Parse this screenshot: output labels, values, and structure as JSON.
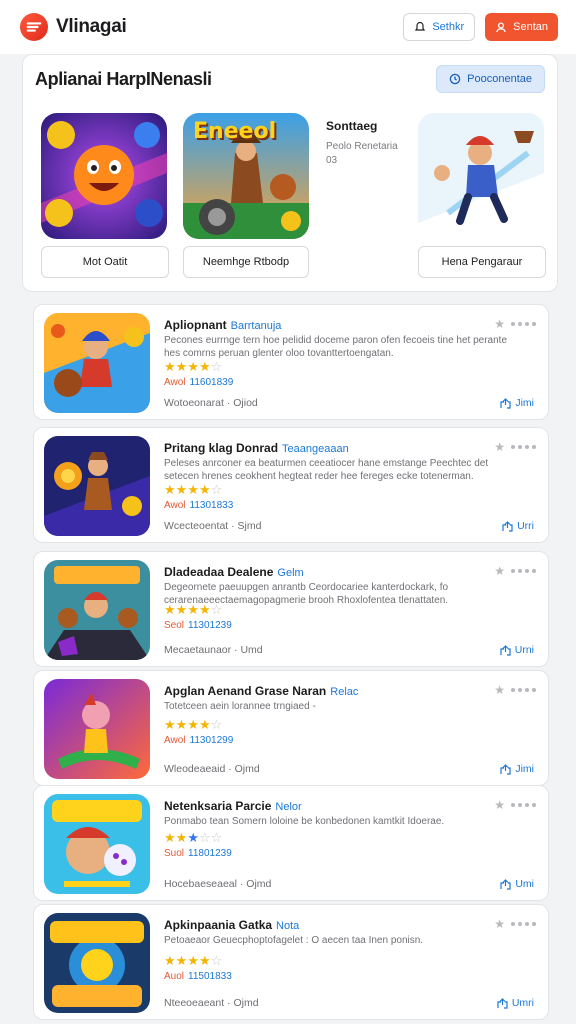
{
  "header": {
    "brand": "Vlinagai",
    "outline_button": "Sethkr",
    "primary_button": "Sentan"
  },
  "featured": {
    "title": "Aplianai HarpINenasli",
    "action_button": "Pooconentae",
    "cards": [
      {
        "button": "Mot Oatit",
        "icon": "monster-game-art"
      },
      {
        "button": "Neemhge Rtbodp",
        "icon": "cowboy-game-art",
        "art_text": "Eneeol"
      },
      {
        "button": "Hena Pengaraur",
        "icon": "hero-game-art"
      }
    ],
    "side_text": {
      "title": "Sonttaeg",
      "line1": "Peolo Renetaria",
      "line2": "03"
    }
  },
  "items": [
    {
      "title": "Apliopnant",
      "tag": "Barrtanuja",
      "desc": "Pecones eurrnge tern hoe pelidid doceme paron ofen fecoeis tine het perante hes comrns peruan glenter oloo tovanttertoengatan.",
      "stars": [
        1,
        1,
        1,
        1,
        0
      ],
      "meta_label": "Awol",
      "meta_value": "11601839",
      "footer": "Wotoeonarat · Ojiod",
      "share": "Jimi"
    },
    {
      "title": "Pritang klag Donrad",
      "tag": "Teaangeaaan",
      "desc": "Peleses anrconer ea beaturmen ceeatiocer hane emstange Peechtec det setecen hrenes ceokhent hegteat reder hee fereges ecke totenerman.",
      "stars": [
        1,
        1,
        1,
        1,
        0
      ],
      "meta_label": "Awol",
      "meta_value": "11301833",
      "footer": "Wcecteoentat · Sjmd",
      "share": "Urri"
    },
    {
      "title": "Dladeadaa Dealene",
      "tag": "Gelm",
      "desc": "Degeornete paeuupgen anrantb Ceordocariee kanterdockark, fo cerarenaeeectaemagopagmerie brooh Rhoxlofentea tlenattaten.",
      "stars": [
        1,
        1,
        1,
        1,
        0
      ],
      "meta_label": "Seol",
      "meta_value": "11301239",
      "footer": "Mecaetaunaor · Umd",
      "share": "Urni"
    },
    {
      "title": "Apglan Aenand Grase Naran",
      "tag": "Relac",
      "desc": "Totetceen aein lorannee trngiaed -",
      "stars": [
        1,
        1,
        1,
        1,
        0
      ],
      "meta_label": "Awol",
      "meta_value": "11301299",
      "footer": "Wleodeaeaid · Ojmd",
      "share": "Jimi"
    },
    {
      "title": "Netenksaria Parcie",
      "tag": "Nelor",
      "desc": "Ponmabo tean Somern loloine be konbedonen kamtkit Idoerae.",
      "stars": [
        1,
        1,
        2,
        0,
        0
      ],
      "meta_label": "Suol",
      "meta_value": "11801239",
      "footer": "Hocebaeseaeal · Ojmd",
      "share": "Umi"
    },
    {
      "title": "Apkinpaania Gatka",
      "tag": "Nota",
      "desc": "Petoaeaor Geuecphoptofagelet : O aecen taa Inen ponisn.",
      "stars": [
        1,
        1,
        1,
        1,
        0
      ],
      "meta_label": "Auol",
      "meta_value": "11501833",
      "footer": "Nteeoeaeant · Ojmd",
      "share": "Umri"
    }
  ],
  "colors": {
    "accent": "#f0552f",
    "link": "#1b78d6",
    "star": "#f4b400"
  }
}
